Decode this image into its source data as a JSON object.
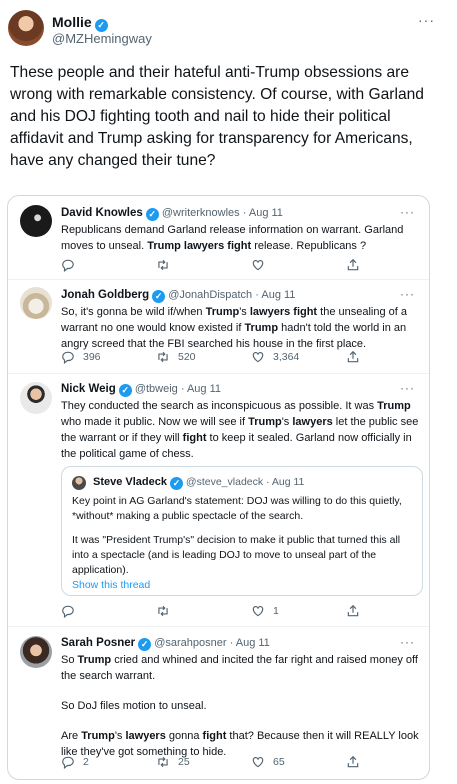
{
  "tweet": {
    "author_name": "Mollie",
    "author_handle": "@MZHemingway",
    "more_label": "···",
    "text": "These people and their hateful anti-Trump obsessions are wrong with remarkable consistency. Of course, with Garland and his DOJ fighting tooth and nail to hide their political affidavit and Trump asking for transparency for Americans, have any changed their tune?"
  },
  "quoted_thread": [
    {
      "name": "David Knowles",
      "handle": "@writerknowles",
      "sep": "·",
      "date": "Aug 11",
      "text_parts": [
        "Republicans demand Garland release information on warrant. Garland moves to unseal. ",
        "Trump lawyers fight",
        " release. Republicans ?"
      ],
      "replies": "",
      "retweets": "",
      "likes": ""
    },
    {
      "name": "Jonah Goldberg",
      "handle": "@JonahDispatch",
      "sep": "·",
      "date": "Aug 11",
      "text_parts": [
        "So, it's gonna be wild if/when ",
        "Trump",
        "'s ",
        "lawyers fight",
        " the unsealing of a warrant no one would know existed if ",
        "Trump",
        " hadn't told the world in an angry screed that the FBI searched his house in the first place."
      ],
      "replies": "396",
      "retweets": "520",
      "likes": "3,364"
    },
    {
      "name": "Nick Weig",
      "handle": "@tbweig",
      "sep": "·",
      "date": "Aug 11",
      "text_parts": [
        "They conducted the search as inconspicuous as possible. It was ",
        "Trump",
        " who made it public. Now we will see if ",
        "Trump",
        "'s ",
        "lawyers",
        " let the public see the warrant or if they will ",
        "fight",
        " to keep it sealed. Garland now officially in the political game of chess."
      ],
      "replies": "",
      "retweets": "",
      "likes": "1",
      "inner_quote": {
        "name": "Steve Vladeck",
        "handle": "@steve_vladeck",
        "sep": "·",
        "date": "Aug 11",
        "para1": "Key point in AG Garland's statement: DOJ was willing to do this quietly, *without* making a public spectacle of the search.",
        "para2": "It was \"President Trump's\" decision to make it public that turned this all into a spectacle (and is leading DOJ to move to unseal part of the application).",
        "show_thread": "Show this thread"
      }
    },
    {
      "name": "Sarah Posner",
      "handle": "@sarahposner",
      "sep": "·",
      "date": "Aug 11",
      "text_parts": [
        "So ",
        "Trump",
        " cried and whined and incited the far right and raised money off the search warrant."
      ],
      "para2": "So DoJ files motion to unseal.",
      "para3_parts": [
        "Are ",
        "Trump",
        "'s ",
        "lawyers",
        " gonna ",
        "fight",
        " that? Because then it will REALLY look like they've got something to hide."
      ],
      "replies": "2",
      "retweets": "25",
      "likes": "65"
    }
  ],
  "icons": {
    "reply": "reply-icon",
    "retweet": "retweet-icon",
    "like": "heart-icon",
    "share": "share-icon",
    "verified": "verified-badge-icon"
  },
  "colors": {
    "accent": "#1d9bf0",
    "text": "#0f1419",
    "secondary": "#536471",
    "border": "#cfd9de"
  }
}
